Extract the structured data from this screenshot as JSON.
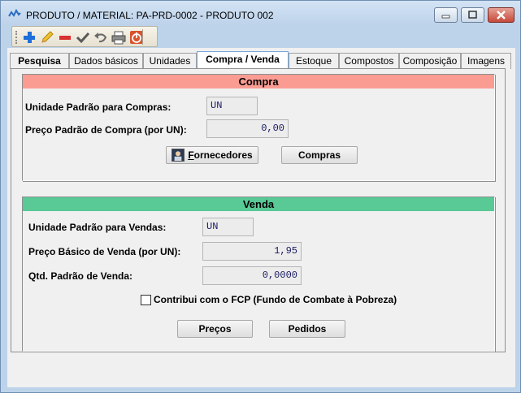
{
  "window": {
    "title": "PRODUTO / MATERIAL: PA-PRD-0002 - PRODUTO 002",
    "controls": {
      "minimize": "▭",
      "maximize": "▢",
      "close": "✕"
    }
  },
  "toolbar": {
    "buttons": [
      {
        "name": "add",
        "icon": "plus-icon",
        "color": "#1e6fd9"
      },
      {
        "name": "edit",
        "icon": "pencil-icon",
        "color": "#e0b000"
      },
      {
        "name": "delete",
        "icon": "minus-icon",
        "color": "#d93030"
      },
      {
        "name": "confirm",
        "icon": "check-icon",
        "color": "#555555"
      },
      {
        "name": "undo",
        "icon": "undo-icon",
        "color": "#555555"
      },
      {
        "name": "print",
        "icon": "printer-icon",
        "color": "#555555"
      },
      {
        "name": "exit",
        "icon": "power-icon",
        "color": "#d9532c"
      }
    ]
  },
  "tabs": [
    {
      "label": "Pesquisa"
    },
    {
      "label": "Dados básicos"
    },
    {
      "label": "Unidades"
    },
    {
      "label": "Compra / Venda"
    },
    {
      "label": "Estoque"
    },
    {
      "label": "Compostos"
    },
    {
      "label": "Composição"
    },
    {
      "label": "Imagens"
    }
  ],
  "active_tab": "Compra / Venda",
  "compra": {
    "header": "Compra",
    "unidade_label": "Unidade Padrão para Compras:",
    "unidade_value": "UN",
    "preco_label": "Preço Padrão de Compra (por UN):",
    "preco_value": "0,00",
    "fornecedores_button_prefix": "F",
    "fornecedores_button_rest": "ornecedores",
    "compras_button": "Compras"
  },
  "venda": {
    "header": "Venda",
    "unidade_label": "Unidade Padrão para Vendas:",
    "unidade_value": "UN",
    "preco_label": "Preço Básico de Venda (por UN):",
    "preco_value": "1,95",
    "qtd_label": "Qtd. Padrão de Venda:",
    "qtd_value": "0,0000",
    "fcp_label": "Contribui com o FCP (Fundo de Combate à Pobreza)",
    "fcp_checked": false,
    "precos_button": "Preços",
    "pedidos_button": "Pedidos"
  },
  "colors": {
    "compra_header": "#fb9c93",
    "venda_header": "#59c996",
    "window_frame": "#bcd3ea"
  }
}
